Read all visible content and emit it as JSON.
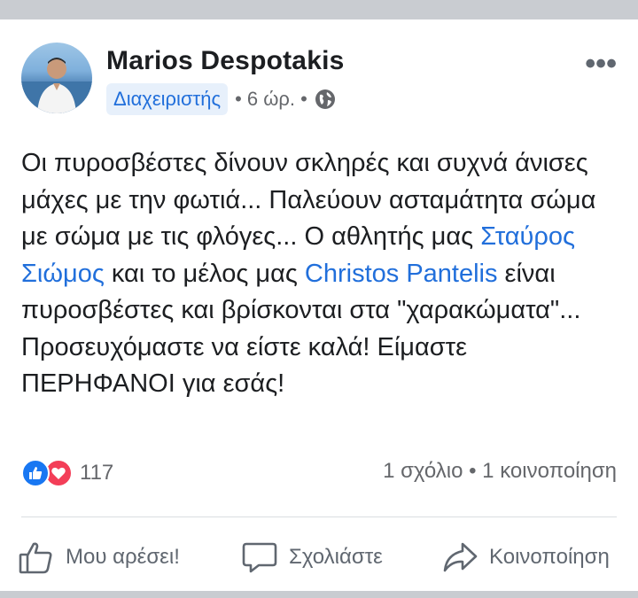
{
  "post": {
    "author": "Marios Despotakis",
    "role_badge": "Διαχειριστής",
    "time": "• 6 ώρ. •",
    "privacy_icon": "globe-icon",
    "more_icon": "more-icon",
    "text_parts": {
      "p1": "Οι πυροσβέστες δίνουν σκληρές και συχνά άνισες μάχες με την φωτιά... Παλεύουν ασταμάτητα σώμα με σώμα με τις φλόγες... Ο αθλητής μας ",
      "mention1": "Σταύρος Σιώμος",
      "p2": " και το μέλος μας ",
      "mention2": "Christos Pantelis",
      "p3": " είναι πυροσβέστες και βρίσκονται στα \"χαρακώματα\"... Προσευχόμαστε να είστε καλά! Είμαστε ΠΕΡΗΦΑΝΟΙ για εσάς!"
    }
  },
  "reactions": {
    "icons": [
      "like-icon",
      "love-icon"
    ],
    "count": "117"
  },
  "counts": {
    "text": "1 σχόλιο • 1 κοινοποίηση"
  },
  "actions": {
    "like": "Μου αρέσει!",
    "comment": "Σχολιάστε",
    "share": "Κοινοποίηση"
  },
  "colors": {
    "link": "#216fdb",
    "text": "#1c1e21",
    "secondary": "#65676b",
    "like": "#1877f2",
    "love": "#f33e58"
  }
}
